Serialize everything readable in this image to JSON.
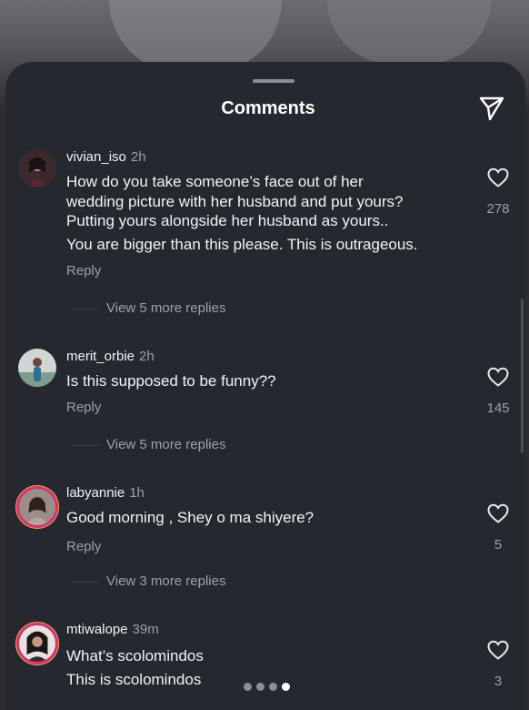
{
  "header": {
    "title": "Comments"
  },
  "comments": [
    {
      "username": "vivian_iso",
      "time": "2h",
      "lines": [
        "How do you take someone’s face out of her",
        "wedding picture with her husband and put yours?",
        "Putting yours alongside her husband as yours..",
        "You are bigger than this please. This is outrageous."
      ],
      "reply_label": "Reply",
      "view_replies": "View 5 more replies",
      "likes": "278"
    },
    {
      "username": "merit_orbie",
      "time": "2h",
      "lines": [
        "Is this supposed to be funny??"
      ],
      "reply_label": "Reply",
      "view_replies": "View 5 more replies",
      "likes": "145"
    },
    {
      "username": "labyannie",
      "time": "1h",
      "lines": [
        "Good morning , Shey o ma shiyere?"
      ],
      "reply_label": "Reply",
      "view_replies": "View 3 more replies",
      "likes": "5"
    },
    {
      "username": "mtiwalope",
      "time": "39m",
      "lines": [
        "What’s scolomindos",
        "This is scolomindos"
      ],
      "likes": "3"
    }
  ],
  "pager": {
    "count": 4,
    "active_index": 3
  },
  "icons": {
    "send": "paper-plane-icon",
    "like": "heart-outline-icon"
  },
  "colors": {
    "sheet_background": "#25292f",
    "primary_text": "#f2f3f5",
    "secondary_text": "#9ba0a8",
    "story_ring": "#d6317a"
  }
}
